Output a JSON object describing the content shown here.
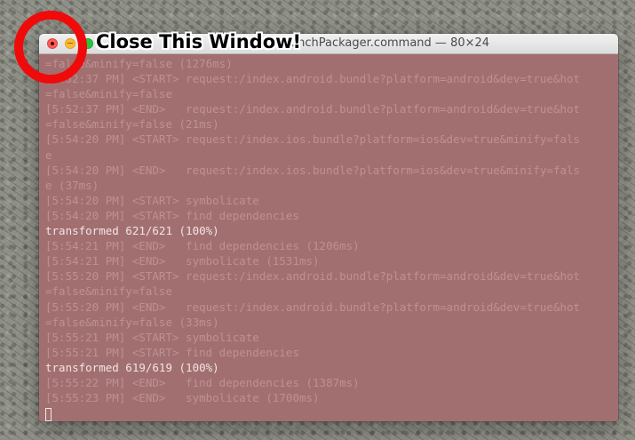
{
  "window": {
    "title": "— node ◂ launchPackager.command — 80×24",
    "close_icon": "close-icon",
    "minimize_icon": "minimize-icon",
    "zoom_icon": "zoom-icon"
  },
  "annotation": {
    "label": "Close This Window!",
    "highlight_color": "#ff0000"
  },
  "colors": {
    "terminal_background": "#a26f71",
    "dim_text": "#bd9192",
    "bright_text": "#f1e5e4"
  },
  "terminal": {
    "lines": [
      {
        "text": "=false&minify=false (1276ms)",
        "bright": false
      },
      {
        "text": "[5:52:37 PM] <START> request:/index.android.bundle?platform=android&dev=true&hot",
        "bright": false
      },
      {
        "text": "=false&minify=false",
        "bright": false
      },
      {
        "text": "[5:52:37 PM] <END>   request:/index.android.bundle?platform=android&dev=true&hot",
        "bright": false
      },
      {
        "text": "=false&minify=false (21ms)",
        "bright": false
      },
      {
        "text": "[5:54:20 PM] <START> request:/index.ios.bundle?platform=ios&dev=true&minify=fals",
        "bright": false
      },
      {
        "text": "e",
        "bright": false
      },
      {
        "text": "[5:54:20 PM] <END>   request:/index.ios.bundle?platform=ios&dev=true&minify=fals",
        "bright": false
      },
      {
        "text": "e (37ms)",
        "bright": false
      },
      {
        "text": "[5:54:20 PM] <START> symbolicate",
        "bright": false
      },
      {
        "text": "[5:54:20 PM] <START> find dependencies",
        "bright": false
      },
      {
        "text": "transformed 621/621 (100%)",
        "bright": true
      },
      {
        "text": "[5:54:21 PM] <END>   find dependencies (1206ms)",
        "bright": false
      },
      {
        "text": "[5:54:21 PM] <END>   symbolicate (1531ms)",
        "bright": false
      },
      {
        "text": "[5:55:20 PM] <START> request:/index.android.bundle?platform=android&dev=true&hot",
        "bright": false
      },
      {
        "text": "=false&minify=false",
        "bright": false
      },
      {
        "text": "[5:55:20 PM] <END>   request:/index.android.bundle?platform=android&dev=true&hot",
        "bright": false
      },
      {
        "text": "=false&minify=false (33ms)",
        "bright": false
      },
      {
        "text": "[5:55:21 PM] <START> symbolicate",
        "bright": false
      },
      {
        "text": "[5:55:21 PM] <START> find dependencies",
        "bright": false
      },
      {
        "text": "transformed 619/619 (100%)",
        "bright": true
      },
      {
        "text": "[5:55:22 PM] <END>   find dependencies (1387ms)",
        "bright": false
      },
      {
        "text": "[5:55:23 PM] <END>   symbolicate (1700ms)",
        "bright": false
      }
    ]
  }
}
